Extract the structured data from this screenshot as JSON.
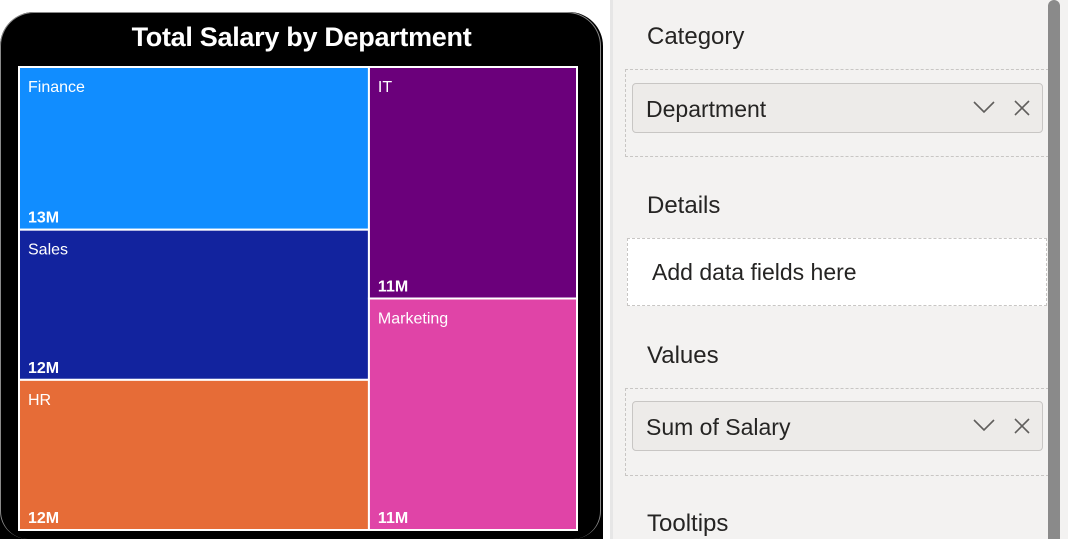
{
  "visual": {
    "title": "Total Salary by Department"
  },
  "chart_data": {
    "type": "treemap",
    "title": "Total Salary by Department",
    "items": [
      {
        "label": "Finance",
        "value_label": "13M",
        "value": 13,
        "color": "#118dff"
      },
      {
        "label": "Sales",
        "value_label": "12M",
        "value": 12,
        "color": "#12239e"
      },
      {
        "label": "HR",
        "value_label": "12M",
        "value": 12,
        "color": "#e66c37"
      },
      {
        "label": "IT",
        "value_label": "11M",
        "value": 11,
        "color": "#6b007b"
      },
      {
        "label": "Marketing",
        "value_label": "11M",
        "value": 11,
        "color": "#e044a7"
      }
    ]
  },
  "fields_pane": {
    "category": {
      "label": "Category",
      "field": "Department"
    },
    "details": {
      "label": "Details",
      "placeholder": "Add data fields here"
    },
    "values": {
      "label": "Values",
      "field": "Sum of Salary"
    },
    "tooltips": {
      "label": "Tooltips"
    }
  },
  "colors": {
    "pane_bg": "#f3f2f1",
    "pill_bg": "#edebe9",
    "visual_bg": "#000000"
  }
}
